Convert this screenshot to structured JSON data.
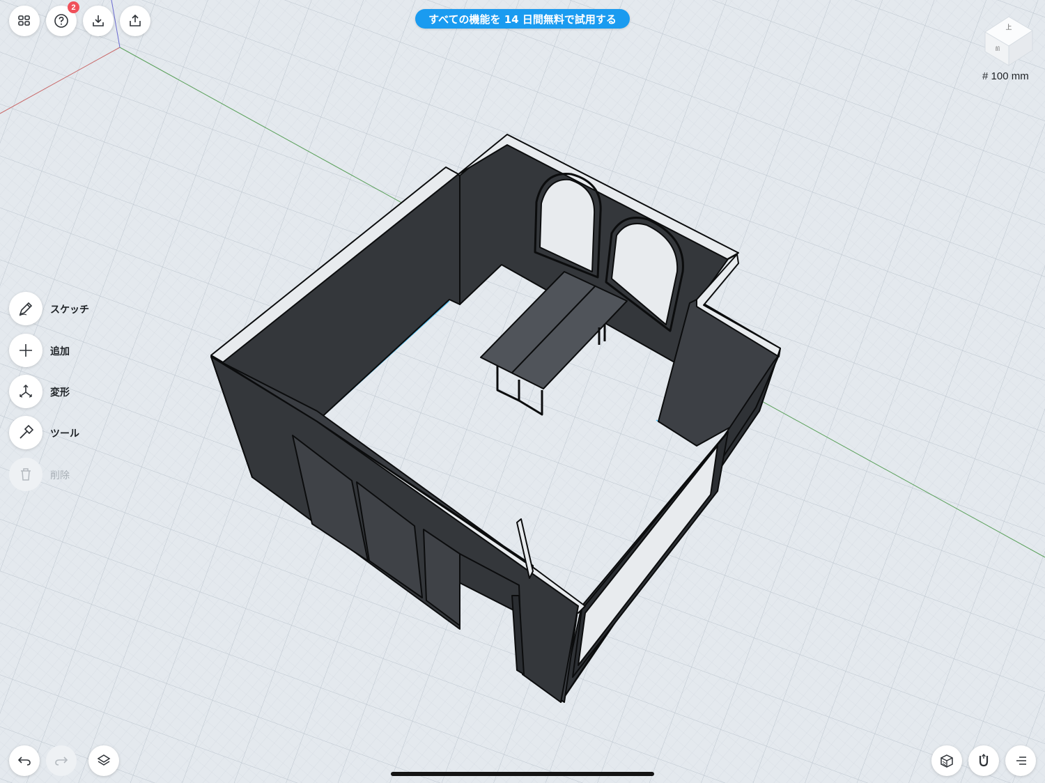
{
  "toolbar": {
    "help_badge": "2"
  },
  "banner": {
    "text": "すべての機能を 14 日間無料で試用する",
    "color": "#1a9bf0"
  },
  "tools": [
    {
      "label": "スケッチ",
      "icon": "pencil-icon",
      "enabled": true
    },
    {
      "label": "追加",
      "icon": "plus-icon",
      "enabled": true
    },
    {
      "label": "変形",
      "icon": "transform-icon",
      "enabled": true
    },
    {
      "label": "ツール",
      "icon": "hammer-icon",
      "enabled": true
    },
    {
      "label": "削除",
      "icon": "trash-icon",
      "enabled": false
    }
  ],
  "view_cube": {
    "face_label": "前",
    "side_label": "上"
  },
  "grid_size": "# 100 mm",
  "bottom_bar": {
    "left": [
      "undo-icon",
      "redo-icon",
      "layers-icon"
    ],
    "right": [
      "view-style-icon",
      "snap-magnet-icon",
      "menu-icon"
    ]
  },
  "scene": {
    "wall_color": "#34373b",
    "wall_top_color": "#e8ebee",
    "grid_bg": "#e4e9ee"
  }
}
